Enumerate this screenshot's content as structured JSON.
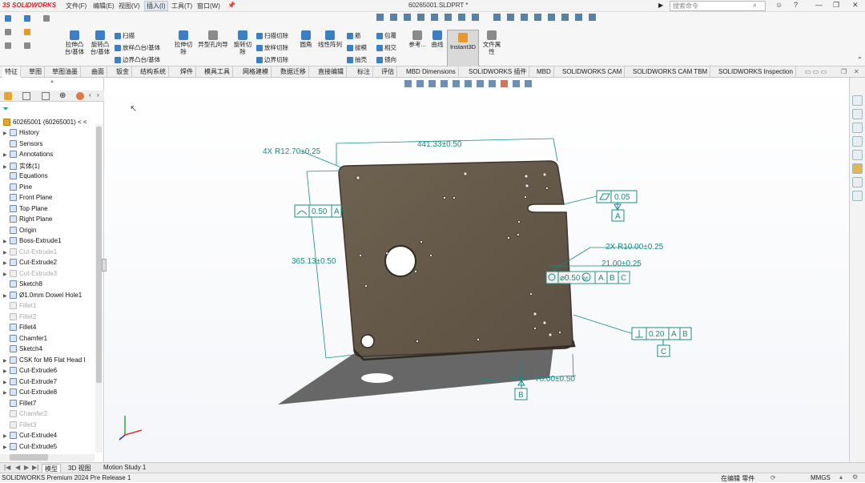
{
  "titlebar": {
    "logo": "3S SOLIDWORKS",
    "menus": [
      "文件(F)",
      "编辑(E)",
      "视图(V)",
      "插入(I)",
      "工具(T)",
      "窗口(W)"
    ],
    "active_menu": "插入(I)",
    "document_title": "60265001.SLDPRT *",
    "search_placeholder": "搜索命令"
  },
  "ribbon": {
    "commands": [
      {
        "label": "拉伸凸\n台/基体",
        "icon": "extruded-boss-icon"
      },
      {
        "label": "旋转凸\n台/基体",
        "icon": "revolved-boss-icon"
      },
      {
        "label": "扫描",
        "icon": "swept-boss-icon"
      },
      {
        "label": "放样凸台/基体",
        "icon": "lofted-boss-icon"
      },
      {
        "label": "边界凸台/基体",
        "icon": "boundary-boss-icon"
      },
      {
        "label": "拉伸切\n除",
        "icon": "extruded-cut-icon"
      },
      {
        "label": "异型孔向导",
        "icon": "hole-wizard-icon"
      },
      {
        "label": "旋转切\n除",
        "icon": "revolved-cut-icon"
      },
      {
        "label": "扫描切除",
        "icon": "swept-cut-icon"
      },
      {
        "label": "放样切除",
        "icon": "lofted-cut-icon"
      },
      {
        "label": "边界切除",
        "icon": "boundary-cut-icon"
      },
      {
        "label": "圆角",
        "icon": "fillet-icon"
      },
      {
        "label": "线性阵列",
        "icon": "linear-pattern-icon"
      },
      {
        "label": "筋",
        "icon": "rib-icon"
      },
      {
        "label": "拔模",
        "icon": "draft-icon"
      },
      {
        "label": "抽壳",
        "icon": "shell-icon"
      },
      {
        "label": "包覆",
        "icon": "wrap-icon"
      },
      {
        "label": "相交",
        "icon": "intersect-icon"
      },
      {
        "label": "镜向",
        "icon": "mirror-icon"
      },
      {
        "label": "参考...",
        "icon": "reference-geometry-icon"
      },
      {
        "label": "曲线",
        "icon": "curves-icon"
      },
      {
        "label": "Instant3D",
        "icon": "instant3d-icon"
      },
      {
        "label": "文件属\n性",
        "icon": "file-properties-icon"
      }
    ]
  },
  "tabs": [
    "特征",
    "草图",
    "草图油墨",
    "曲面",
    "钣金",
    "结构系统",
    "焊件",
    "模具工具",
    "网格建模",
    "数据迁移",
    "直接编辑",
    "标注",
    "评估",
    "MBD Dimensions",
    "SOLIDWORKS 插件",
    "MBD",
    "SOLIDWORKS CAM",
    "SOLIDWORKS CAM TBM",
    "SOLIDWORKS Inspection"
  ],
  "active_tab": "特征",
  "feature_tree": {
    "root": "60265001 (60265001) < <",
    "items": [
      {
        "label": "History",
        "arrow": true,
        "dim": false
      },
      {
        "label": "Sensors",
        "arrow": false,
        "dim": false
      },
      {
        "label": "Annotations",
        "arrow": true,
        "dim": false
      },
      {
        "label": "实体(1)",
        "arrow": true,
        "dim": false
      },
      {
        "label": "Equations",
        "arrow": false,
        "dim": false
      },
      {
        "label": "Pine",
        "arrow": false,
        "dim": false
      },
      {
        "label": "Front Plane",
        "arrow": false,
        "dim": false
      },
      {
        "label": "Top Plane",
        "arrow": false,
        "dim": false
      },
      {
        "label": "Right Plane",
        "arrow": false,
        "dim": false
      },
      {
        "label": "Origin",
        "arrow": false,
        "dim": false
      },
      {
        "label": "Boss-Extrude1",
        "arrow": true,
        "dim": false
      },
      {
        "label": "Cut-Extrude1",
        "arrow": true,
        "dim": true
      },
      {
        "label": "Cut-Extrude2",
        "arrow": true,
        "dim": false
      },
      {
        "label": "Cut-Extrude3",
        "arrow": true,
        "dim": true
      },
      {
        "label": "Sketch8",
        "arrow": false,
        "dim": false
      },
      {
        "label": "Ø1.0mm Dowel Hole1",
        "arrow": true,
        "dim": false
      },
      {
        "label": "Fillet1",
        "arrow": false,
        "dim": true
      },
      {
        "label": "Fillet2",
        "arrow": false,
        "dim": true
      },
      {
        "label": "Fillet4",
        "arrow": false,
        "dim": false
      },
      {
        "label": "Chamfer1",
        "arrow": false,
        "dim": false
      },
      {
        "label": "Sketch4",
        "arrow": false,
        "dim": false
      },
      {
        "label": "CSK for M6 Flat Head I",
        "arrow": true,
        "dim": false
      },
      {
        "label": "Cut-Extrude6",
        "arrow": true,
        "dim": false
      },
      {
        "label": "Cut-Extrude7",
        "arrow": true,
        "dim": false
      },
      {
        "label": "Cut-Extrude8",
        "arrow": true,
        "dim": false
      },
      {
        "label": "Fillet7",
        "arrow": false,
        "dim": false
      },
      {
        "label": "Chamfer2",
        "arrow": false,
        "dim": true
      },
      {
        "label": "Fillet3",
        "arrow": false,
        "dim": true
      },
      {
        "label": "Cut-Extrude4",
        "arrow": true,
        "dim": false
      },
      {
        "label": "Cut-Extrude5",
        "arrow": true,
        "dim": false
      }
    ]
  },
  "annotations": {
    "corner_radius": "4X R12.70±0.25",
    "width": "441.33±0.50",
    "height": "365.13±0.50",
    "flatness": "0.50",
    "flatness_datum": "A",
    "parallelism": "0.05",
    "datum_a": "A",
    "slot_radius": "2X R10.00±0.25",
    "slot_width": "21.00±0.25",
    "position_tol": "⌀0.50",
    "position_mod": "M",
    "position_refs": [
      "A",
      "B",
      "C"
    ],
    "perp_tol": "0.20",
    "perp_refs": [
      "A",
      "B"
    ],
    "datum_c": "C",
    "bottom_dim": "76.00±0.50",
    "datum_b": "B"
  },
  "bottom_tabs": [
    "模型",
    "3D 视图",
    "Motion Study 1"
  ],
  "active_bottom_tab": "模型",
  "status": {
    "left": "SOLIDWORKS Premium 2024 Pre Release 1",
    "mode": "在编辑 零件",
    "units": "MMGS"
  }
}
